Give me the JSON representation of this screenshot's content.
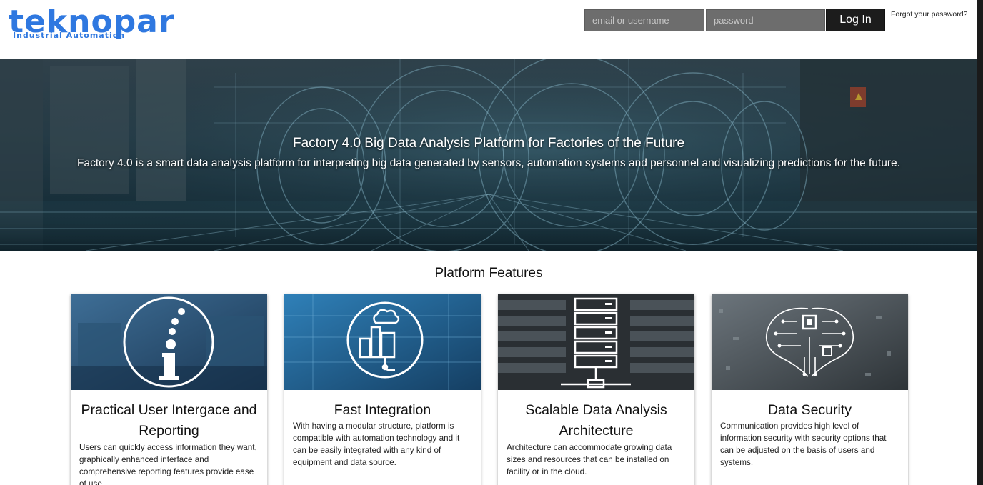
{
  "logo": {
    "main": "teknopar",
    "sub": "Industrial Automation"
  },
  "login": {
    "email_placeholder": "email or username",
    "password_placeholder": "password",
    "button_label": "Log In",
    "forgot_label": "Forgot your password?"
  },
  "hero": {
    "title": "Factory 4.0 Big Data Analysis Platform for Factories of the Future",
    "subtitle": "Factory 4.0 is a smart data analysis platform for interpreting big data generated by sensors, automation systems and personnel and visualizing predictions for the future."
  },
  "features": {
    "title": "Platform Features",
    "cards": [
      {
        "icon": "info-icon",
        "title": "Practical User Intergace and Reporting",
        "text": "Users can quickly access information they want, graphically enhanced interface and comprehensive reporting features provide ease of use."
      },
      {
        "icon": "factory-icon",
        "title": "Fast Integration",
        "text": "With having a modular structure, platform is compatible with automation technology and it can be easily integrated with any kind of equipment and data source."
      },
      {
        "icon": "server-icon",
        "title": "Scalable Data Analysis Architecture",
        "text": "Architecture can accommodate growing data sizes and resources that can be installed on facility or in the cloud."
      },
      {
        "icon": "circuit-brain-icon",
        "title": "Data Security",
        "text": "Communication provides high level of information security with security options that can be adjusted on the basis of users and systems."
      }
    ]
  },
  "colors": {
    "brand": "#2f78e0",
    "login_button": "#1c1c1c",
    "input_bg": "#6d6d6d"
  }
}
